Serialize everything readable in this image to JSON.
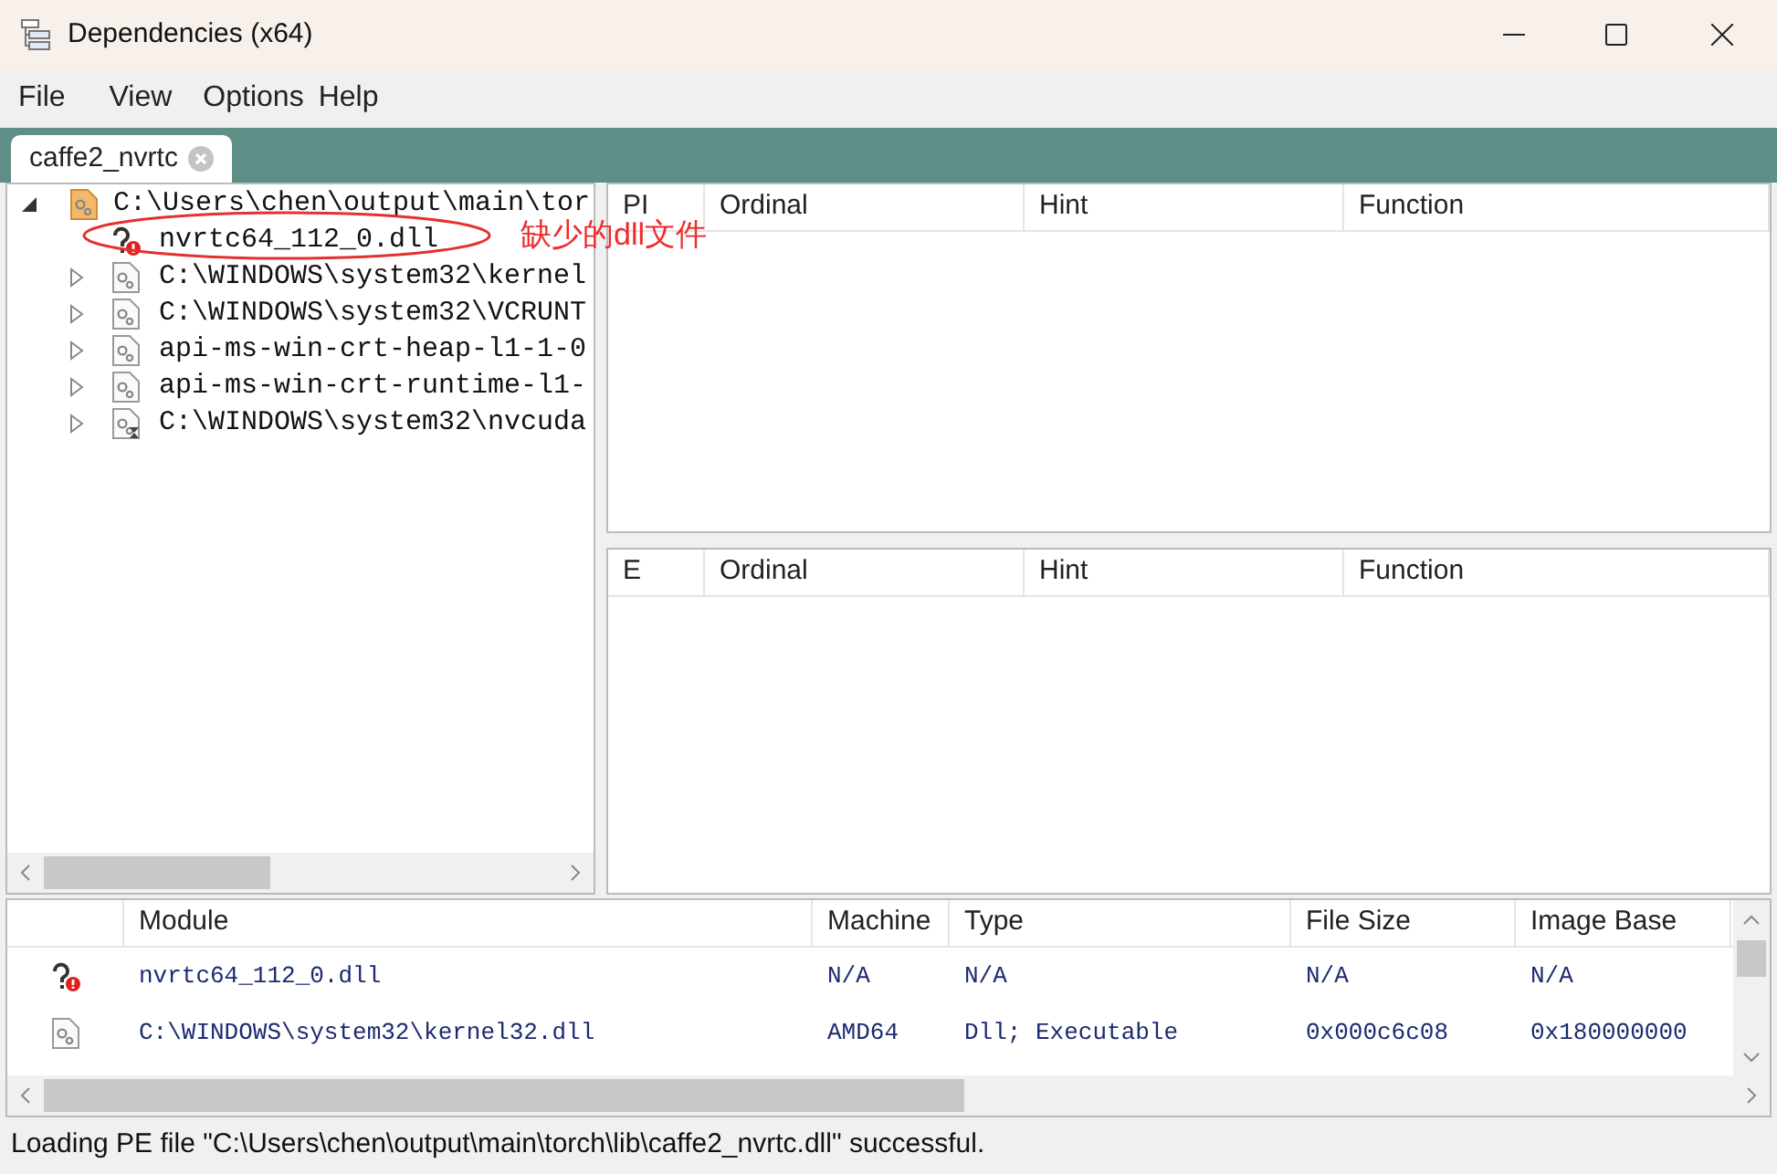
{
  "window": {
    "title": "Dependencies (x64)"
  },
  "menu": [
    "File",
    "View",
    "Options",
    "Help"
  ],
  "tabs": [
    {
      "label": "caffe2_nvrtc",
      "selected": true
    }
  ],
  "tree": [
    {
      "label": "C:\\Users\\chen\\output\\main\\tor",
      "kind": "root",
      "expanded": true,
      "children": [
        {
          "label": "nvrtc64_112_0.dll",
          "kind": "missing"
        },
        {
          "label": "C:\\WINDOWS\\system32\\kernel",
          "kind": "dll",
          "expanded": false
        },
        {
          "label": "C:\\WINDOWS\\system32\\VCRUNT",
          "kind": "dll",
          "expanded": false
        },
        {
          "label": "api-ms-win-crt-heap-l1-1-0",
          "kind": "dll",
          "expanded": false
        },
        {
          "label": "api-ms-win-crt-runtime-l1-",
          "kind": "dll",
          "expanded": false
        },
        {
          "label": "C:\\WINDOWS\\system32\\nvcuda",
          "kind": "delay",
          "expanded": false
        }
      ]
    }
  ],
  "annotation": {
    "text": "缺少的dll文件"
  },
  "imports_table": {
    "columns": [
      "PI",
      "Ordinal",
      "Hint",
      "Function"
    ]
  },
  "exports_table": {
    "columns": [
      "E",
      "Ordinal",
      "Hint",
      "Function"
    ]
  },
  "modules_table": {
    "columns": [
      "Module",
      "Machine",
      "Type",
      "File Size",
      "Image Base"
    ],
    "rows": [
      {
        "kind": "missing",
        "cells": [
          "nvrtc64_112_0.dll",
          "N/A",
          "N/A",
          "N/A",
          "N/A"
        ]
      },
      {
        "kind": "dll",
        "cells": [
          "C:\\WINDOWS\\system32\\kernel32.dll",
          "AMD64",
          "Dll; Executable",
          "0x000c6c08",
          "0x180000000"
        ]
      }
    ]
  },
  "status_bar": "Loading PE file \"C:\\Users\\chen\\output\\main\\torch\\lib\\caffe2_nvrtc.dll\" successful."
}
